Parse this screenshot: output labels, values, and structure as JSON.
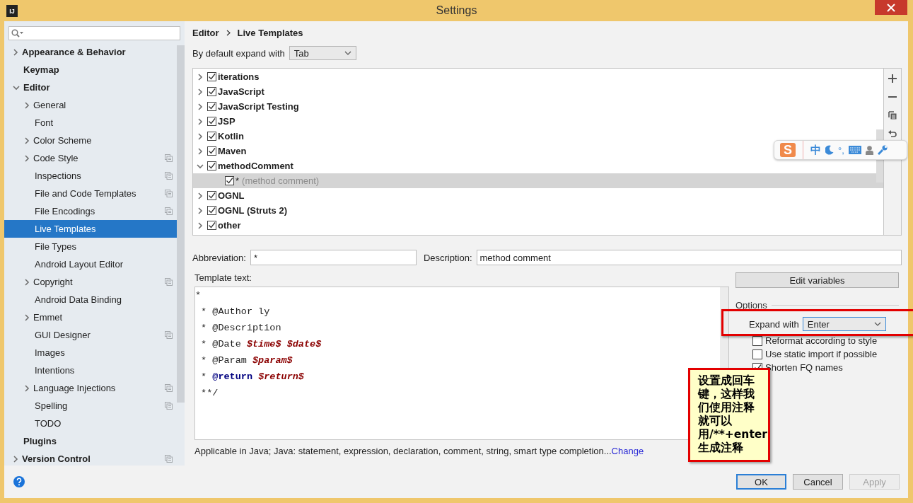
{
  "window": {
    "title": "Settings",
    "app_icon_text": "IJ"
  },
  "sidebar": {
    "items": [
      {
        "label": "Appearance & Behavior",
        "expandable": true,
        "expanded": false,
        "shared": false,
        "selected": false
      },
      {
        "label": "Keymap",
        "expandable": false,
        "shared": false,
        "selected": false
      },
      {
        "label": "Editor",
        "expandable": true,
        "expanded": true,
        "shared": false,
        "selected": false,
        "children": [
          {
            "label": "General",
            "expandable": true,
            "expanded": false,
            "shared": false,
            "selected": false
          },
          {
            "label": "Font",
            "expandable": false,
            "shared": false,
            "selected": false
          },
          {
            "label": "Color Scheme",
            "expandable": true,
            "expanded": false,
            "shared": false,
            "selected": false
          },
          {
            "label": "Code Style",
            "expandable": true,
            "expanded": false,
            "shared": true,
            "selected": false
          },
          {
            "label": "Inspections",
            "expandable": false,
            "shared": true,
            "selected": false
          },
          {
            "label": "File and Code Templates",
            "expandable": false,
            "shared": true,
            "selected": false
          },
          {
            "label": "File Encodings",
            "expandable": false,
            "shared": true,
            "selected": false
          },
          {
            "label": "Live Templates",
            "expandable": false,
            "shared": false,
            "selected": true
          },
          {
            "label": "File Types",
            "expandable": false,
            "shared": false,
            "selected": false
          },
          {
            "label": "Android Layout Editor",
            "expandable": false,
            "shared": false,
            "selected": false
          },
          {
            "label": "Copyright",
            "expandable": true,
            "expanded": false,
            "shared": true,
            "selected": false
          },
          {
            "label": "Android Data Binding",
            "expandable": false,
            "shared": false,
            "selected": false
          },
          {
            "label": "Emmet",
            "expandable": true,
            "expanded": false,
            "shared": false,
            "selected": false
          },
          {
            "label": "GUI Designer",
            "expandable": false,
            "shared": true,
            "selected": false
          },
          {
            "label": "Images",
            "expandable": false,
            "shared": false,
            "selected": false
          },
          {
            "label": "Intentions",
            "expandable": false,
            "shared": false,
            "selected": false
          },
          {
            "label": "Language Injections",
            "expandable": true,
            "expanded": false,
            "shared": true,
            "selected": false
          },
          {
            "label": "Spelling",
            "expandable": false,
            "shared": true,
            "selected": false
          },
          {
            "label": "TODO",
            "expandable": false,
            "shared": false,
            "selected": false
          }
        ]
      },
      {
        "label": "Plugins",
        "expandable": false,
        "shared": false,
        "selected": false
      },
      {
        "label": "Version Control",
        "expandable": true,
        "expanded": false,
        "shared": true,
        "selected": false
      }
    ]
  },
  "breadcrumb": [
    "Editor",
    "Live Templates"
  ],
  "default_expand": {
    "label": "By default expand with",
    "value": "Tab"
  },
  "template_groups": [
    {
      "name": "iterations",
      "checked": true,
      "expanded": false,
      "selected": false
    },
    {
      "name": "JavaScript",
      "checked": true,
      "expanded": false,
      "selected": false
    },
    {
      "name": "JavaScript Testing",
      "checked": true,
      "expanded": false,
      "selected": false
    },
    {
      "name": "JSP",
      "checked": true,
      "expanded": false,
      "selected": false
    },
    {
      "name": "Kotlin",
      "checked": true,
      "expanded": false,
      "selected": false
    },
    {
      "name": "Maven",
      "checked": true,
      "expanded": false,
      "selected": false
    },
    {
      "name": "methodComment",
      "checked": true,
      "expanded": true,
      "selected": false,
      "children": [
        {
          "name": "*",
          "description": "(method comment)",
          "checked": true,
          "selected": true
        }
      ]
    },
    {
      "name": "OGNL",
      "checked": true,
      "expanded": false,
      "selected": false
    },
    {
      "name": "OGNL (Struts 2)",
      "checked": true,
      "expanded": false,
      "selected": false
    },
    {
      "name": "other",
      "checked": true,
      "expanded": false,
      "selected": false
    }
  ],
  "abbreviation": {
    "label": "Abbreviation:",
    "value": "*"
  },
  "description": {
    "label": "Description:",
    "value": "method comment"
  },
  "template_text": {
    "label": "Template text:",
    "lines": [
      [
        {
          "text": "*",
          "kind": "plain"
        }
      ],
      [
        {
          "text": " * @Author ly",
          "kind": "plain"
        }
      ],
      [
        {
          "text": " * @Description",
          "kind": "plain"
        }
      ],
      [
        {
          "text": " * @Date ",
          "kind": "plain"
        },
        {
          "text": "$time$ $date$",
          "kind": "variable"
        }
      ],
      [
        {
          "text": " * @Param ",
          "kind": "plain"
        },
        {
          "text": "$param$",
          "kind": "variable"
        }
      ],
      [
        {
          "text": " * ",
          "kind": "plain"
        },
        {
          "text": "@return",
          "kind": "keyword"
        },
        {
          "text": " $return$",
          "kind": "variable"
        }
      ],
      [
        {
          "text": " **/",
          "kind": "plain"
        }
      ]
    ]
  },
  "edit_variables_button": "Edit variables",
  "options": {
    "title": "Options",
    "expand_with": {
      "label": "Expand with",
      "value": "Enter"
    },
    "checkboxes": [
      {
        "label": "Reformat according to style",
        "checked": false
      },
      {
        "label": "Use static import if possible",
        "checked": false
      },
      {
        "label": "Shorten FQ names",
        "checked": true
      }
    ]
  },
  "applicable": {
    "text": "Applicable in Java; Java: statement, expression, declaration, comment, string, smart type completion...",
    "link": "Change"
  },
  "buttons": [
    {
      "label": "OK",
      "kind": "default",
      "disabled": false
    },
    {
      "label": "Cancel",
      "kind": "normal",
      "disabled": false
    },
    {
      "label": "Apply",
      "kind": "normal",
      "disabled": true
    }
  ],
  "ime": {
    "logo_text": "S",
    "mode_label": "中",
    "punct_label": "°,"
  },
  "annotation": {
    "lines": [
      "设置成回车",
      "键，这样我",
      "们使用注释",
      "就可以",
      "用/**+enter",
      "生成注释"
    ]
  }
}
